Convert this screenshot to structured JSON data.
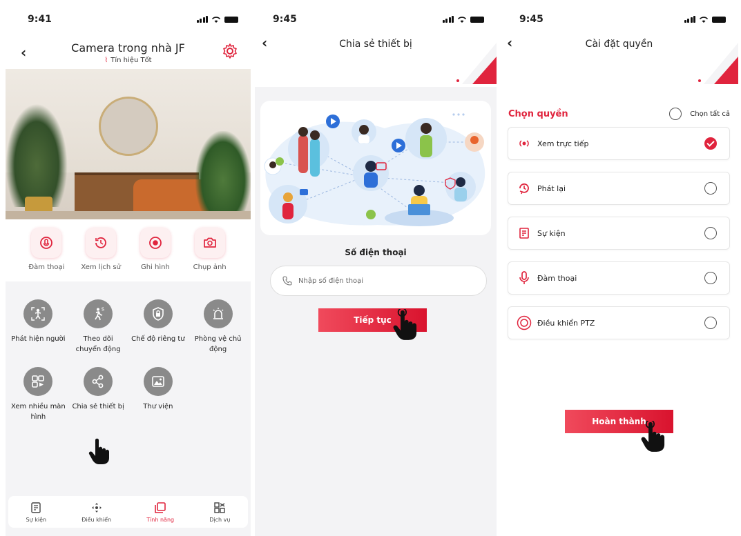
{
  "colors": {
    "accent": "#e0243d",
    "gray_icon": "#8a8a8a"
  },
  "screen1": {
    "time": "9:41",
    "title": "Camera trong nhà JF",
    "signal_label": "Tín hiệu Tốt",
    "actions": [
      {
        "icon": "intercom-icon",
        "label": "Đàm thoại"
      },
      {
        "icon": "history-icon",
        "label": "Xem lịch sử"
      },
      {
        "icon": "record-icon",
        "label": "Ghi hình"
      },
      {
        "icon": "camera-icon",
        "label": "Chụp ảnh"
      }
    ],
    "features": [
      {
        "icon": "person-detect-icon",
        "label": "Phát hiện người"
      },
      {
        "icon": "motion-track-icon",
        "label": "Theo dõi chuyển động"
      },
      {
        "icon": "privacy-icon",
        "label": "Chế độ riêng tư"
      },
      {
        "icon": "alarm-icon",
        "label": "Phòng vệ chủ động"
      },
      {
        "icon": "multi-screen-icon",
        "label": "Xem nhiều màn hình"
      },
      {
        "icon": "share-icon",
        "label": "Chia sẻ thiết bị"
      },
      {
        "icon": "gallery-icon",
        "label": "Thư viện"
      }
    ],
    "tabs": [
      {
        "icon": "event-icon",
        "label": "Sự kiện",
        "active": false
      },
      {
        "icon": "control-icon",
        "label": "Điều khiển",
        "active": false
      },
      {
        "icon": "features-icon",
        "label": "Tính năng",
        "active": true
      },
      {
        "icon": "services-icon",
        "label": "Dịch vụ",
        "active": false
      }
    ]
  },
  "screen2": {
    "time": "9:45",
    "title": "Chia sẻ thiết bị",
    "phone_label": "Số điện thoại",
    "phone_placeholder": "Nhập số điện thoại",
    "continue_label": "Tiếp tục"
  },
  "screen3": {
    "time": "9:45",
    "title": "Cài đặt quyền",
    "choose_label": "Chọn quyền",
    "select_all_label": "Chọn tất cả",
    "permissions": [
      {
        "icon": "live-icon",
        "label": "Xem trực tiếp",
        "checked": true
      },
      {
        "icon": "playback-icon",
        "label": "Phát lại",
        "checked": false
      },
      {
        "icon": "event-list-icon",
        "label": "Sự kiện",
        "checked": false
      },
      {
        "icon": "microphone-icon",
        "label": "Đàm thoại",
        "checked": false
      },
      {
        "icon": "ptz-icon",
        "label": "Điều khiển PTZ",
        "checked": false
      }
    ],
    "done_label": "Hoàn thành"
  }
}
